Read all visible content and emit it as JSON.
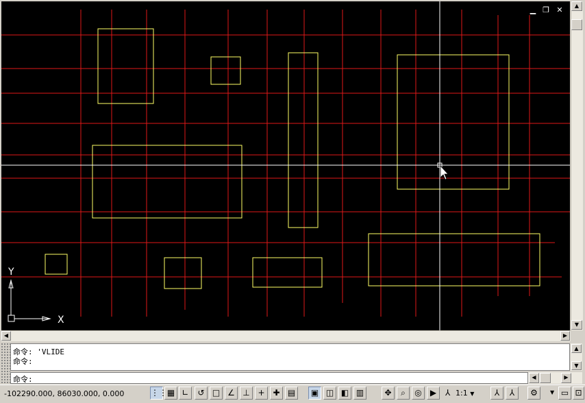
{
  "command_window": {
    "history": [
      "命令: 'VLIDE",
      "命令:"
    ],
    "prompt": "命令:"
  },
  "status_bar": {
    "coordinates": "-102290.000, 86030.000, 0.000",
    "annotation_scale": "1:1"
  },
  "ucs": {
    "x_label": "X",
    "y_label": "Y"
  },
  "colors": {
    "background": "#000000",
    "grid_lines": "#e01818",
    "rectangles": "#ffff66",
    "crosshair": "#ffffff"
  },
  "icons": {
    "viewport_controls": [
      "minimize-icon",
      "restore-icon",
      "close-icon"
    ],
    "status_toggles": [
      "snap-icon",
      "grid-icon",
      "ortho-icon",
      "polar-icon",
      "osnap-icon",
      "otrack-icon",
      "ducs-icon",
      "dyn-icon",
      "lineweight-icon",
      "qp-icon"
    ],
    "navigation": [
      "model-icon",
      "layout1-icon",
      "layout2-icon",
      "quickview-icon",
      "pan-icon",
      "zoom-icon",
      "steeringwheel-icon",
      "showmotion-icon"
    ],
    "annotation": [
      "annotation-scale-icon",
      "annotation-visibility-icon",
      "auto-scale-icon",
      "workspace-icon",
      "lock-icon",
      "clean-screen-icon"
    ]
  }
}
